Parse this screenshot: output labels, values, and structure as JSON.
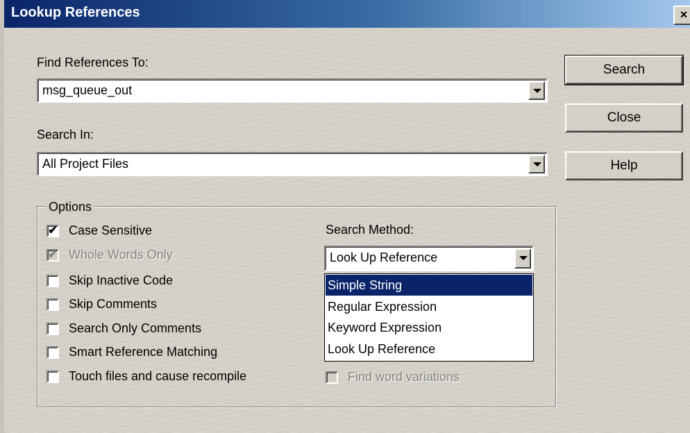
{
  "window": {
    "title": "Lookup References",
    "close_glyph": "×"
  },
  "find_references": {
    "label": "Find References To:",
    "value": "msg_queue_out"
  },
  "search_in": {
    "label": "Search In:",
    "value": "All Project Files"
  },
  "buttons": {
    "search": "Search",
    "close": "Close",
    "help": "Help"
  },
  "options": {
    "legend": "Options",
    "checkboxes": [
      {
        "label": "Case Sensitive",
        "checked": true,
        "enabled": true
      },
      {
        "label": "Whole Words Only",
        "checked": true,
        "enabled": false
      },
      {
        "label": "Skip Inactive Code",
        "checked": false,
        "enabled": true
      },
      {
        "label": "Skip Comments",
        "checked": false,
        "enabled": true
      },
      {
        "label": "Search Only Comments",
        "checked": false,
        "enabled": true
      },
      {
        "label": "Smart Reference Matching",
        "checked": false,
        "enabled": true
      },
      {
        "label": "Touch files and cause recompile",
        "checked": false,
        "enabled": true
      }
    ],
    "search_method": {
      "label": "Search Method:",
      "value": "Look Up Reference",
      "open_list": [
        "Simple String",
        "Regular Expression",
        "Keyword Expression",
        "Look Up Reference"
      ],
      "highlighted": "Simple String"
    },
    "find_word_variations": {
      "label": "Find word variations",
      "checked": false,
      "enabled": false
    }
  },
  "colors": {
    "titlebar_start": "#0a246a",
    "titlebar_end": "#a6caf0",
    "dialog_face": "#d4d0c8",
    "selection": "#0a246a"
  },
  "icons": {
    "checkmark": "check-icon",
    "dropdown": "chevron-down-icon",
    "close": "close-icon"
  }
}
